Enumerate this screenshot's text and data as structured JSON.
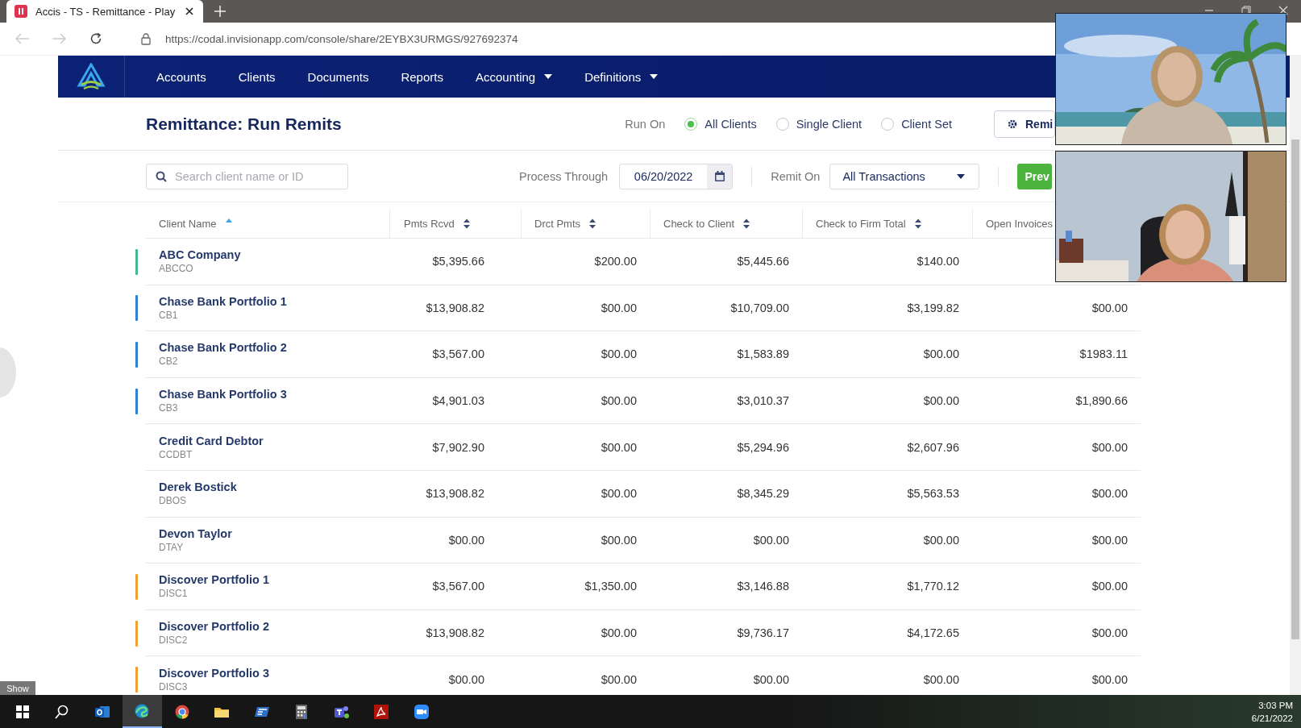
{
  "browser": {
    "tab_title": "Accis - TS - Remittance - Play",
    "url": "https://codal.invisionapp.com/console/share/2EYBX3URMGS/927692374"
  },
  "nav": {
    "items": [
      {
        "label": "Accounts",
        "has_menu": false
      },
      {
        "label": "Clients",
        "has_menu": false
      },
      {
        "label": "Documents",
        "has_menu": false
      },
      {
        "label": "Reports",
        "has_menu": false
      },
      {
        "label": "Accounting",
        "has_menu": true
      },
      {
        "label": "Definitions",
        "has_menu": true
      }
    ]
  },
  "page": {
    "title": "Remittance: Run Remits",
    "run_on": {
      "label": "Run On",
      "options": [
        {
          "label": "All Clients",
          "selected": true
        },
        {
          "label": "Single Client",
          "selected": false
        },
        {
          "label": "Client Set",
          "selected": false
        }
      ]
    },
    "remit_button": "Remi",
    "search": {
      "placeholder": "Search client name or ID"
    },
    "process_through": {
      "label": "Process Through",
      "value": "06/20/2022"
    },
    "remit_on": {
      "label": "Remit On",
      "value": "All Transactions"
    },
    "preview_button": "Prev"
  },
  "table": {
    "columns": [
      {
        "label": "Client Name",
        "sorted": true
      },
      {
        "label": "Pmts Rcvd",
        "sorted": false
      },
      {
        "label": "Drct Pmts",
        "sorted": false
      },
      {
        "label": "Check to Client",
        "sorted": false
      },
      {
        "label": "Check to Firm Total",
        "sorted": false
      },
      {
        "label": "Open Invoices"
      }
    ],
    "rows": [
      {
        "name": "ABC Company",
        "code": "ABCCO",
        "color": "#3dbb8a",
        "values": [
          "$5,395.66",
          "$200.00",
          "$5,445.66",
          "$140.00"
        ]
      },
      {
        "name": "Chase Bank Portfolio 1",
        "code": "CB1",
        "color": "#2d7fd0",
        "values": [
          "$13,908.82",
          "$00.00",
          "$10,709.00",
          "$3,199.82",
          "$00.00"
        ]
      },
      {
        "name": "Chase Bank Portfolio 2",
        "code": "CB2",
        "color": "#2d7fd0",
        "values": [
          "$3,567.00",
          "$00.00",
          "$1,583.89",
          "$00.00",
          "$1983.11"
        ]
      },
      {
        "name": "Chase Bank Portfolio 3",
        "code": "CB3",
        "color": "#2d7fd0",
        "values": [
          "$4,901.03",
          "$00.00",
          "$3,010.37",
          "$00.00",
          "$1,890.66"
        ]
      },
      {
        "name": "Credit Card Debtor",
        "code": "CCDBT",
        "values": [
          "$7,902.90",
          "$00.00",
          "$5,294.96",
          "$2,607.96",
          "$00.00"
        ]
      },
      {
        "name": "Derek Bostick",
        "code": "DBOS",
        "values": [
          "$13,908.82",
          "$00.00",
          "$8,345.29",
          "$5,563.53",
          "$00.00"
        ]
      },
      {
        "name": "Devon Taylor",
        "code": "DTAY",
        "values": [
          "$00.00",
          "$00.00",
          "$00.00",
          "$00.00",
          "$00.00"
        ]
      },
      {
        "name": "Discover Portfolio 1",
        "code": "DISC1",
        "color": "#f0a030",
        "values": [
          "$3,567.00",
          "$1,350.00",
          "$3,146.88",
          "$1,770.12",
          "$00.00"
        ]
      },
      {
        "name": "Discover Portfolio 2",
        "code": "DISC2",
        "color": "#f0a030",
        "values": [
          "$13,908.82",
          "$00.00",
          "$9,736.17",
          "$4,172.65",
          "$00.00"
        ]
      },
      {
        "name": "Discover Portfolio 3",
        "code": "DISC3",
        "color": "#f0a030",
        "values": [
          "$00.00",
          "$00.00",
          "$00.00",
          "$00.00",
          "$00.00"
        ]
      }
    ]
  },
  "show_button": "Show",
  "taskbar": {
    "apps": [
      {
        "kind": "start",
        "active": false
      },
      {
        "kind": "search",
        "active": false
      },
      {
        "kind": "mail",
        "active": false
      },
      {
        "kind": "browser-wave",
        "active": true
      },
      {
        "kind": "browser-ring",
        "active": false
      },
      {
        "kind": "folder",
        "active": false
      },
      {
        "kind": "app-tile",
        "active": false
      },
      {
        "kind": "calculator",
        "active": false
      },
      {
        "kind": "chat",
        "active": false
      },
      {
        "kind": "pdf",
        "active": false
      },
      {
        "kind": "camera",
        "active": false
      }
    ],
    "time": "3:03 PM",
    "date": "6/21/2022"
  }
}
